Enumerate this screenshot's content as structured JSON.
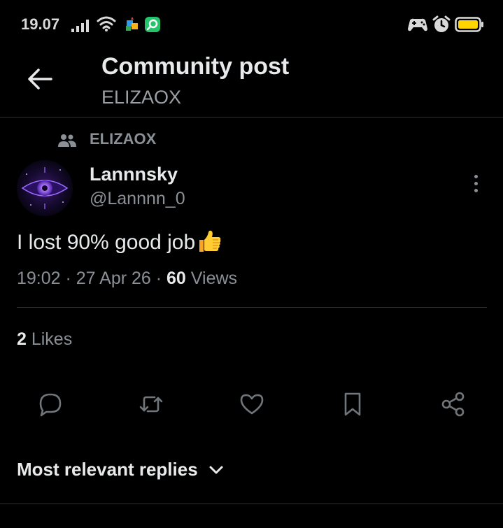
{
  "status_bar": {
    "time": "19.07",
    "icons": [
      "signal-icon",
      "wifi-icon",
      "app-icon",
      "app-icon",
      "game-icon",
      "alarm-icon",
      "battery-icon"
    ],
    "battery_color": "#ffd400"
  },
  "header": {
    "title": "Community post",
    "subtitle": "ELIZAOX"
  },
  "post": {
    "community": "ELIZAOX",
    "author_name": "Lannnsky",
    "author_handle": "@Lannnn_0",
    "text": "I lost 90% good job",
    "time": "19:02",
    "separator_1": " · ",
    "date": "27 Apr 26",
    "separator_2": " · ",
    "views": "60",
    "views_label": " Views",
    "likes": "2",
    "likes_label": " Likes"
  },
  "actions": [
    "reply-icon",
    "repost-icon",
    "heart-icon",
    "bookmark-icon",
    "share-icon"
  ],
  "replies_sort": {
    "label": "Most relevant replies"
  },
  "colors": {
    "background": "#000000",
    "primary_text": "#e7e9ea",
    "secondary_text": "#8b9096",
    "divider": "#2f3336"
  }
}
